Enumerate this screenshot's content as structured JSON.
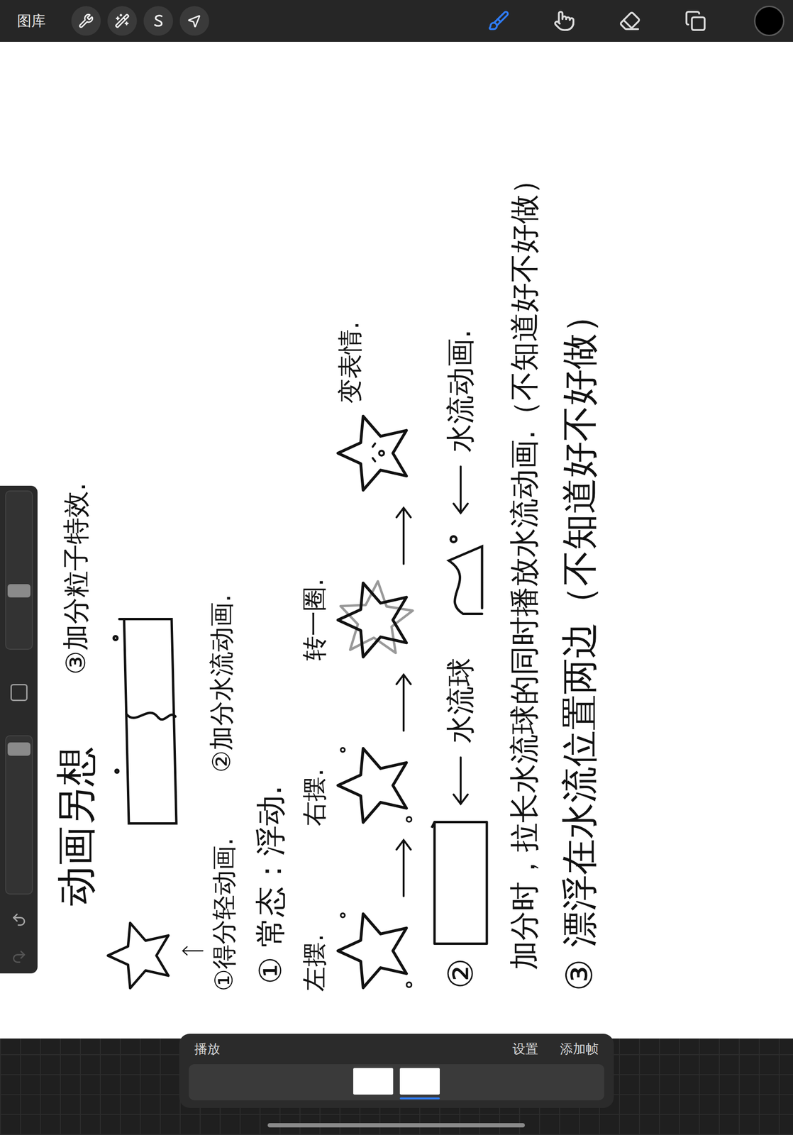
{
  "toolbar": {
    "gallery": "图库",
    "left_tools": [
      {
        "kind": "wrench"
      },
      {
        "kind": "adjust"
      },
      {
        "kind": "select"
      },
      {
        "kind": "transform"
      }
    ],
    "right_tools": [
      {
        "kind": "brush",
        "selected": true
      },
      {
        "kind": "smudge",
        "selected": false
      },
      {
        "kind": "eraser",
        "selected": false
      },
      {
        "kind": "layers",
        "selected": false
      }
    ],
    "color": "#000000"
  },
  "sidebar": {
    "size_level": 0.35,
    "opacity_level": 0.95,
    "undo_enabled": true,
    "redo_enabled": false
  },
  "canvas": {
    "title": "动画另想",
    "particle_note": "③加分粒子特效.",
    "score_note": "①得分轻动画.",
    "water_note": "②加分水流动画.",
    "idle": {
      "heading": "① 常态：浮动.",
      "steps": [
        {
          "label": "左摆.",
          "kind": "sway"
        },
        {
          "label": "右摆.",
          "kind": "sway"
        },
        {
          "label": "转一圈.",
          "kind": "spin"
        },
        {
          "label": "变表情.",
          "kind": "face"
        }
      ]
    },
    "water": {
      "number": "②",
      "ball": "水流球",
      "animation": "水流动画."
    },
    "note": "加分时，拉长水流球的同时播放水流动画.（不知道好不好做）",
    "float": "③ 漂浮在水流位置两边（不知道好不好做）"
  },
  "animation": {
    "play": "播放",
    "settings": "设置",
    "add_frame": "添加帧",
    "frames": [
      {
        "selected": false
      },
      {
        "selected": true
      }
    ]
  }
}
